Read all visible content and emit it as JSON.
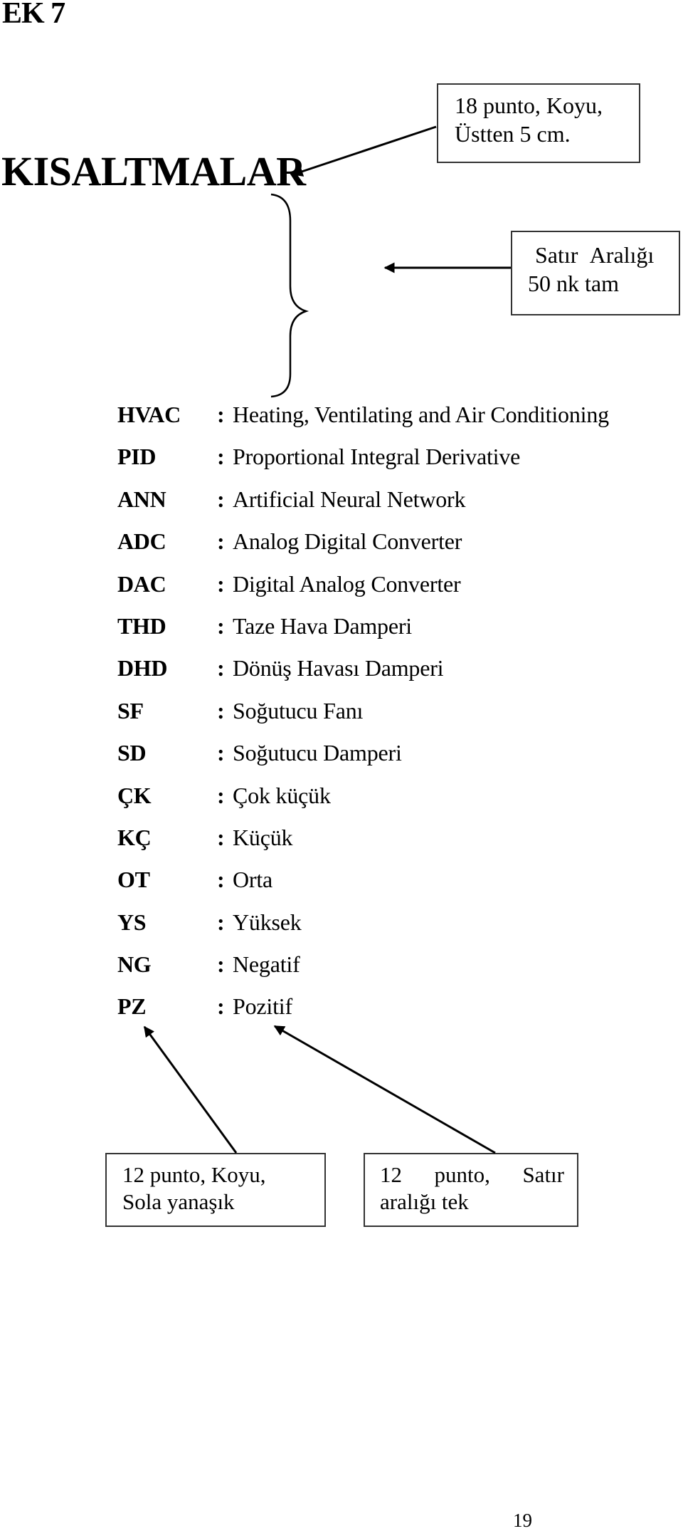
{
  "page": {
    "annex_label": "EK 7",
    "title": "KISALTMALAR",
    "page_number": "19"
  },
  "notes": {
    "heading_format": {
      "lines": [
        "18 punto, Koyu,",
        "Üstten 5 cm."
      ]
    },
    "line_spacing": {
      "lines": [
        "Satır Aralığı",
        "50 nk tam"
      ]
    },
    "term_format": {
      "lines": [
        "12 punto, Koyu,",
        "Sola yanaşık"
      ]
    },
    "definition_format": {
      "line1_parts": [
        "12",
        "punto,",
        "Satır"
      ],
      "line2": "aralığı tek"
    }
  },
  "abbreviations": [
    {
      "term": "HVAC",
      "separator": ":",
      "definition": "Heating, Ventilating and Air Conditioning"
    },
    {
      "term": "PID",
      "separator": ":",
      "definition": "Proportional Integral Derivative"
    },
    {
      "term": "ANN",
      "separator": ":",
      "definition": "Artificial Neural Network"
    },
    {
      "term": "ADC",
      "separator": ":",
      "definition": "Analog Digital Converter"
    },
    {
      "term": "DAC",
      "separator": ":",
      "definition": "Digital Analog Converter"
    },
    {
      "term": "THD",
      "separator": ":",
      "definition": "Taze Hava Damperi"
    },
    {
      "term": "DHD",
      "separator": ":",
      "definition": "Dönüş Havası Damperi"
    },
    {
      "term": "SF",
      "separator": ":",
      "definition": "Soğutucu Fanı"
    },
    {
      "term": "SD",
      "separator": ":",
      "definition": "Soğutucu Damperi"
    },
    {
      "term": "ÇK",
      "separator": ":",
      "definition": "Çok küçük"
    },
    {
      "term": "KÇ",
      "separator": ":",
      "definition": "Küçük"
    },
    {
      "term": "OT",
      "separator": ":",
      "definition": "Orta"
    },
    {
      "term": "YS",
      "separator": ":",
      "definition": "Yüksek"
    },
    {
      "term": "NG",
      "separator": ":",
      "definition": "Negatif"
    },
    {
      "term": "PZ",
      "separator": ":",
      "definition": "Pozitif"
    }
  ],
  "colors": {
    "text": "#000000",
    "box_border": "#333333",
    "background": "#ffffff"
  }
}
